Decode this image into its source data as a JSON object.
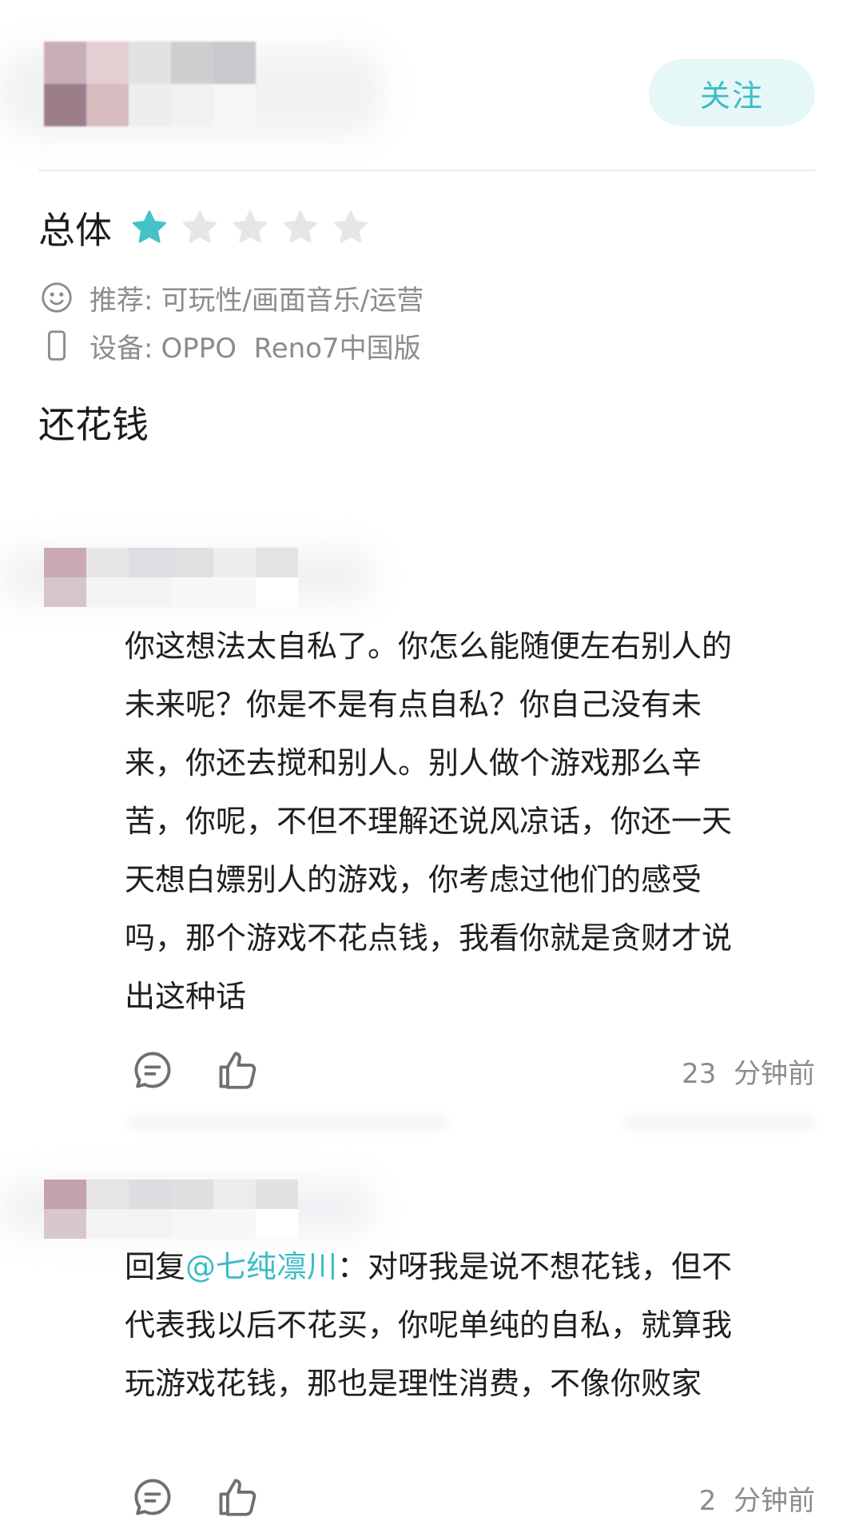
{
  "header": {
    "follow_label": "关注"
  },
  "review": {
    "rating_label": "总体",
    "stars_filled": 1,
    "stars_total": 5,
    "star_color": "#46c1ca",
    "star_empty_color": "#e6e6e6",
    "recommend_label": "推荐:",
    "recommend_value": "可玩性/画面音乐/运营",
    "device_label": "设备:",
    "device_value": "OPPO  Reno7中国版",
    "text": "还花钱"
  },
  "comments": [
    {
      "lines": [
        "你这想法太自私了。你怎么能随便左右别人的",
        "未来呢？你是不是有点自私？你自己没有未",
        "来，你还去搅和别人。别人做个游戏那么辛",
        "苦，你呢，不但不理解还说风凉话，你还一天",
        "天想白嫖别人的游戏，你考虑过他们的感受",
        "吗，那个游戏不花点钱，我看你就是贪财才说",
        "出这种话"
      ],
      "time": "23  分钟前"
    },
    {
      "reply_prefix": "回复",
      "mention": "@七纯凛川",
      "first_line_rest": "：对呀我是说不想花钱，但不",
      "lines": [
        "代表我以后不花买，你呢单纯的自私，就算我",
        "玩游戏花钱，那也是理性消费，不像你败家"
      ],
      "time": "2  分钟前"
    }
  ],
  "colors": {
    "accent": "#3bbdc6",
    "follow_bg": "#e6f7f8",
    "secondary_text": "#8c8c8c"
  }
}
